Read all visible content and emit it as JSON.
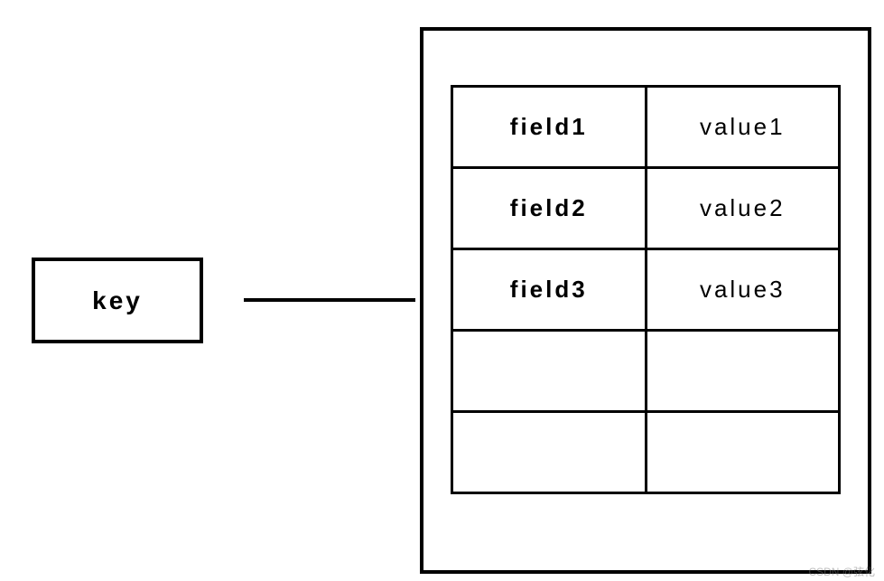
{
  "key_label": "key",
  "rows": [
    {
      "field": "field1",
      "value": "value1"
    },
    {
      "field": "field2",
      "value": "value2"
    },
    {
      "field": "field3",
      "value": "value3"
    },
    {
      "field": "",
      "value": ""
    },
    {
      "field": "",
      "value": ""
    }
  ],
  "watermark": "CSDN @弦化"
}
